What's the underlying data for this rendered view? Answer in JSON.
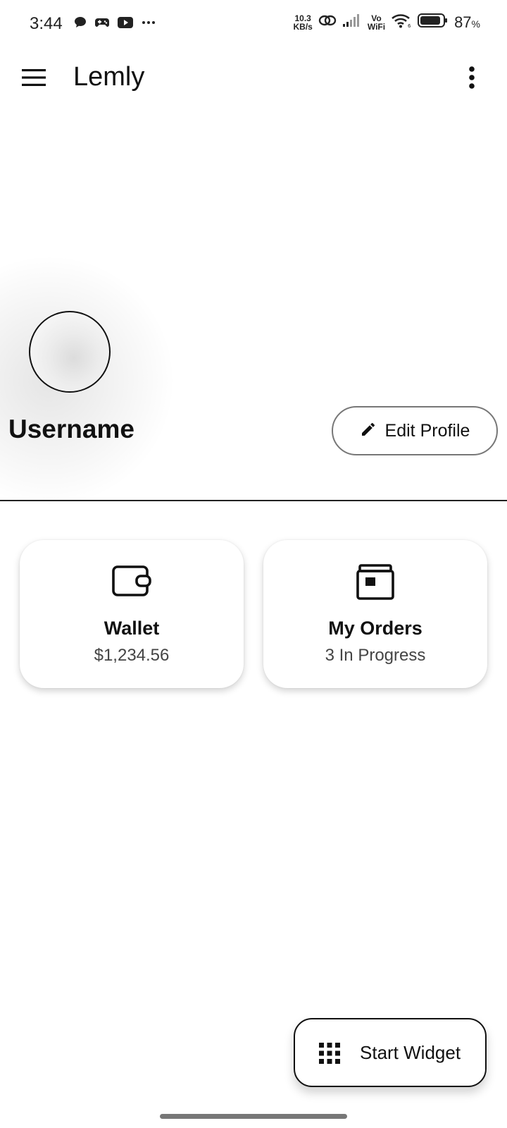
{
  "status_bar": {
    "time": "3:44",
    "net_speed_value": "10.3",
    "net_speed_unit": "KB/s",
    "vo_label": "Vo",
    "wifi_label": "WiFi",
    "battery_percent": "87",
    "percent_sign": "%",
    "left_icons": [
      "chat-bubble-icon",
      "gamepad-icon",
      "youtube-icon",
      "more-dots-icon"
    ],
    "right_icons": [
      "link-icon",
      "signal-bars-icon",
      "wifi-icon",
      "battery-icon"
    ]
  },
  "app_bar": {
    "title": "Lemly",
    "menu_icon": "hamburger-menu-icon",
    "overflow_icon": "more-vertical-icon"
  },
  "profile": {
    "username": "Username",
    "edit_button_label": "Edit Profile",
    "edit_icon": "pencil-icon"
  },
  "cards": {
    "wallet": {
      "title": "Wallet",
      "subtitle": "$1,234.56",
      "icon": "wallet-icon"
    },
    "orders": {
      "title": "My Orders",
      "subtitle": "3 In Progress",
      "icon": "orders-box-icon"
    }
  },
  "fab": {
    "label": "Start Widget",
    "icon": "grid-apps-icon"
  },
  "colors": {
    "text": "#111111",
    "secondary_text": "#444444",
    "border": "#777777",
    "background": "#ffffff"
  }
}
